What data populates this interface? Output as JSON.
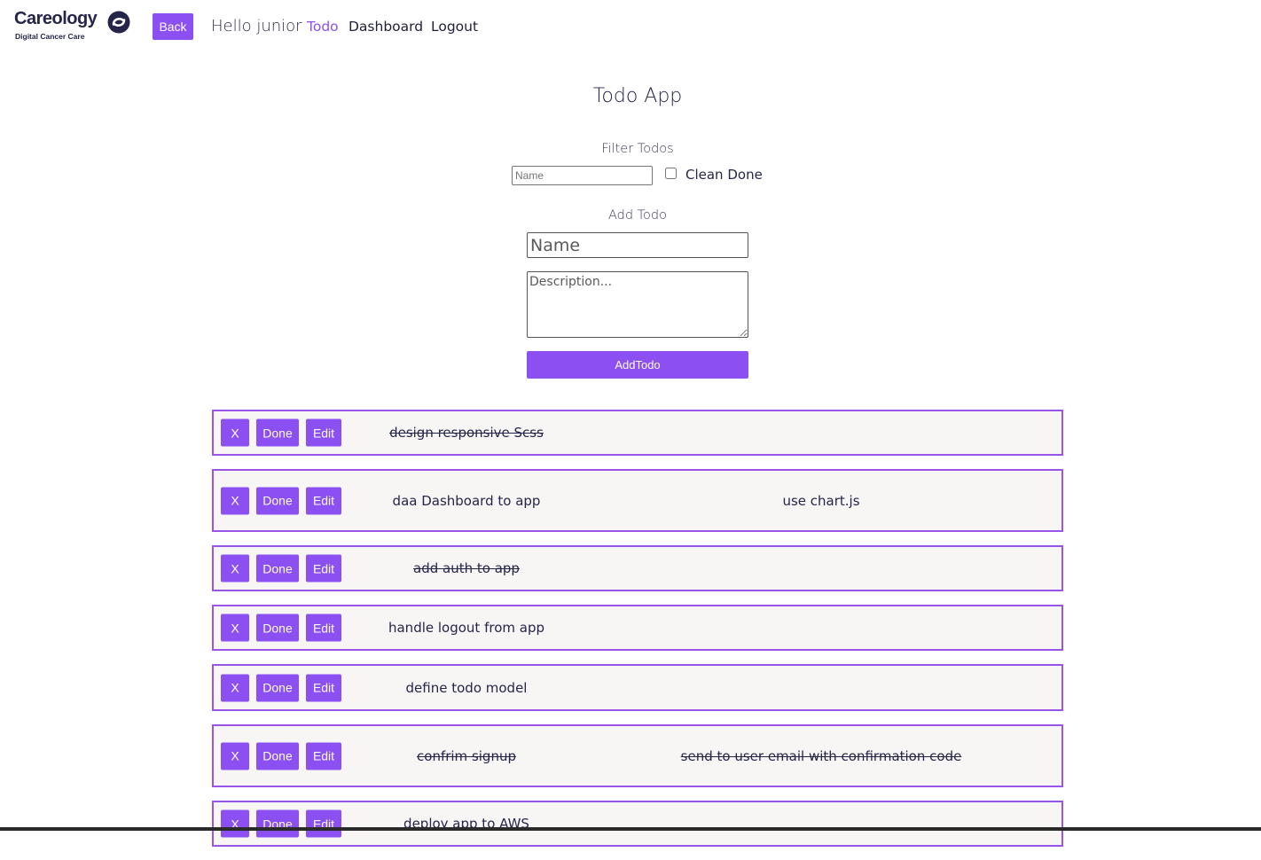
{
  "brand": {
    "name": "Careology",
    "tagline": "Digital Cancer Care",
    "color": "#25254a"
  },
  "accent_color": "#8c4ff2",
  "header": {
    "back_label": "Back",
    "greeting": "Hello junior",
    "nav": {
      "todo": "Todo",
      "dashboard": "Dashboard",
      "logout": "Logout"
    },
    "active_nav": "Todo"
  },
  "main": {
    "title": "Todo App",
    "filter": {
      "label": "Filter Todos",
      "name_placeholder": "Name",
      "clean_done_label": "Clean Done",
      "clean_done_checked": false
    },
    "add": {
      "label": "Add Todo",
      "name_placeholder": "Name",
      "description_placeholder": "Description...",
      "submit_label": "AddTodo"
    }
  },
  "todo_actions": {
    "delete_label": "X",
    "done_label": "Done",
    "edit_label": "Edit"
  },
  "todos": [
    {
      "name": "design responsive Scss",
      "description": "",
      "done": true
    },
    {
      "name": "daa Dashboard to app",
      "description": "use chart.js",
      "done": false
    },
    {
      "name": "add auth to app",
      "description": "",
      "done": true
    },
    {
      "name": "handle logout from app",
      "description": "",
      "done": false
    },
    {
      "name": "define todo model",
      "description": "",
      "done": false
    },
    {
      "name": "confrim signup",
      "description": "send to user email with confirmation code",
      "done": true
    },
    {
      "name": "deploy app to AWS",
      "description": "",
      "done": false
    }
  ]
}
